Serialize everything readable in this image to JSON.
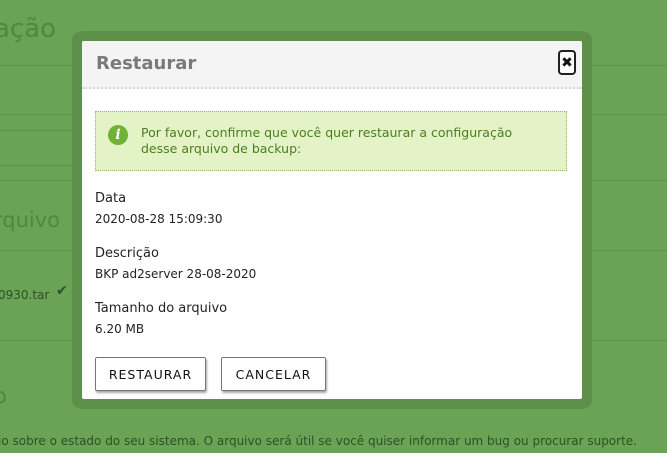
{
  "background": {
    "page_title": "ação",
    "section_title_1": "rquivo",
    "file_name": "0930.tar",
    "section_title_2": "o",
    "bottom_text": "io sobre o estado do seu sistema. O arquivo será útil se você quiser informar um bug ou procurar suporte."
  },
  "modal": {
    "title": "Restaurar",
    "close_icon": "close-icon",
    "alert": {
      "icon": "info-icon",
      "text": "Por favor, confirme que você quer restaurar a configuração desse arquivo de backup:"
    },
    "fields": {
      "date_label": "Data",
      "date_value": "2020-08-28 15:09:30",
      "description_label": "Descrição",
      "description_value": "BKP ad2server 28-08-2020",
      "size_label": "Tamanho do arquivo",
      "size_value": "6.20 MB"
    },
    "buttons": {
      "restore": "RESTAURAR",
      "cancel": "CANCELAR"
    }
  },
  "colors": {
    "overlay": "#6aa356",
    "alert_bg": "#e3f3c6",
    "alert_text": "#4e7d21"
  }
}
